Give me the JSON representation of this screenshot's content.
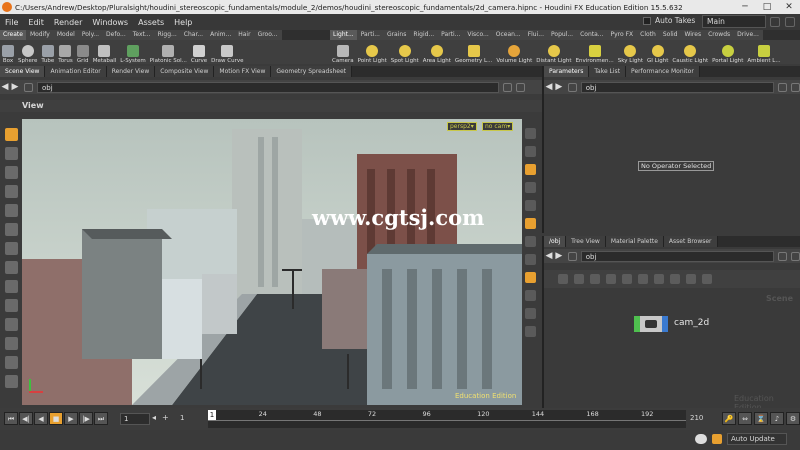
{
  "window": {
    "title": "C:/Users/Andrew/Desktop/Pluralsight/houdini_stereoscopic_fundamentals/module_2/demos/houdini_stereoscopic_fundamentals/2d_camera.hipnc - Houdini FX Education Edition 15.5.632",
    "minimize": "─",
    "maximize": "□",
    "close": "✕"
  },
  "menu": {
    "items": [
      "File",
      "Edit",
      "Render",
      "Windows",
      "Assets",
      "Help"
    ],
    "auto_takes": "Auto Takes",
    "desktop": "Main"
  },
  "shelf_left": {
    "tabs": [
      "Create",
      "Modify",
      "Model",
      "Poly...",
      "Defo...",
      "Text...",
      "Rigg...",
      "Char...",
      "Anim...",
      "Hair",
      "Groo..."
    ],
    "tools": [
      "Box",
      "Sphere",
      "Tube",
      "Torus",
      "Grid",
      "Metaball",
      "L-System",
      "Platonic Sol...",
      "Curve",
      "Draw Curve"
    ],
    "tool_colors": [
      "#9aa0a8",
      "#c8c8c8",
      "#9aa0a8",
      "#a8a8a8",
      "#8a8a8a",
      "#c0c0c0",
      "#5fa05f",
      "#b0b0b0",
      "#d0d0d0",
      "#c8c8c8"
    ]
  },
  "shelf_right": {
    "tabs": [
      "Light...",
      "Parti...",
      "Grains",
      "Rigid...",
      "Parti...",
      "Visco...",
      "Ocean...",
      "Flui...",
      "Popul...",
      "Conta...",
      "Pyro FX",
      "Cloth",
      "Solid",
      "Wires",
      "Crowds",
      "Drive..."
    ],
    "tools": [
      "Camera",
      "Point Light",
      "Spot Light",
      "Area Light",
      "Geometry L...",
      "Volume Light",
      "Distant Light",
      "Environmen...",
      "Sky Light",
      "GI Light",
      "Caustic Light",
      "Portal Light",
      "Ambient L..."
    ],
    "tool_colors": [
      "#b8b8b8",
      "#e6c84a",
      "#e6c84a",
      "#e6c84a",
      "#e6c84a",
      "#e6a53a",
      "#e6c84a",
      "#d8d040",
      "#e6c84a",
      "#e6c84a",
      "#e6c84a",
      "#c8d040",
      "#c8d040"
    ]
  },
  "left_pane": {
    "tabs": [
      "Scene View",
      "Animation Editor",
      "Render View",
      "Composite View",
      "Motion FX View",
      "Geometry Spreadsheet"
    ],
    "path": "obj",
    "view_label": "View",
    "camera_menu": "persp2▾",
    "cam_menu": "no cam▾",
    "watermark": "www.cgtsj.com",
    "edition_label": "Education Edition"
  },
  "right_top": {
    "tabs": [
      "Parameters",
      "Take List",
      "Performance Monitor"
    ],
    "path": "obj",
    "message": "No Operator Selected"
  },
  "right_bottom": {
    "tabs": [
      "/obj",
      "Tree View",
      "Material Palette",
      "Asset Browser"
    ],
    "path": "obj",
    "context_label": "Scene",
    "node_name": "cam_2d",
    "watermark": "Education Edition"
  },
  "timeline": {
    "start_field": "1",
    "start_field2": "1",
    "current_frame": "1",
    "end_frame": "210",
    "ticks": [
      "24",
      "48",
      "72",
      "96",
      "120",
      "144",
      "168",
      "192"
    ]
  },
  "status": {
    "auto_update": "Auto Update"
  },
  "colors": {
    "accent": "#e8731a",
    "sky": "#c9d6cf",
    "watermark": "#ffffff"
  }
}
